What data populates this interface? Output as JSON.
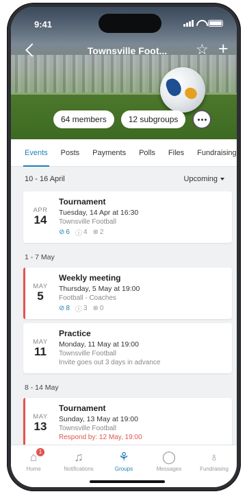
{
  "status_bar": {
    "time": "9:41"
  },
  "header": {
    "title": "Townsville Foot...",
    "members": "64 members",
    "subgroups": "12 subgroups"
  },
  "tabs": [
    "Events",
    "Posts",
    "Payments",
    "Polls",
    "Files",
    "Fundraising"
  ],
  "active_tab": "Events",
  "filter": {
    "week_range": "10 - 16 April",
    "label": "Upcoming"
  },
  "events": {
    "e1": {
      "month": "APR",
      "day": "14",
      "title": "Tournament",
      "time": "Tuesday, 14 Apr at 16:30",
      "group": "Townsville Football",
      "yes": "6",
      "maybe": "4",
      "no": "2"
    },
    "section2": "1 - 7 May",
    "e2": {
      "month": "MAY",
      "day": "5",
      "title": "Weekly meeting",
      "time": "Thursday, 5 May at 19:00",
      "group": "Football - Coaches",
      "yes": "8",
      "maybe": "3",
      "no": "0"
    },
    "e3": {
      "month": "MAY",
      "day": "11",
      "title": "Practice",
      "time": "Monday, 11 May at 19:00",
      "group": "Townsville Football",
      "note": "Invite goes out 3 days in advance"
    },
    "section3": "8 - 14 May",
    "e4": {
      "month": "MAY",
      "day": "13",
      "title": "Tournament",
      "time": "Sunday, 13 May at 19:00",
      "group": "Townsville Football",
      "respond": "Respond by: 12 May, 19:00"
    }
  },
  "nav": {
    "home": "Home",
    "home_badge": "1",
    "notifications": "Notifications",
    "groups": "Groups",
    "messages": "Messages",
    "fundraising": "Fundraising"
  },
  "colors": {
    "accent": "#1e7fb8",
    "alert": "#e0554f"
  },
  "icons": [
    "back-icon",
    "star-icon",
    "plus-icon",
    "more-icon",
    "check-icon",
    "question-icon",
    "x-icon",
    "home-icon",
    "bell-icon",
    "groups-icon",
    "chat-icon",
    "piggybank-icon"
  ]
}
